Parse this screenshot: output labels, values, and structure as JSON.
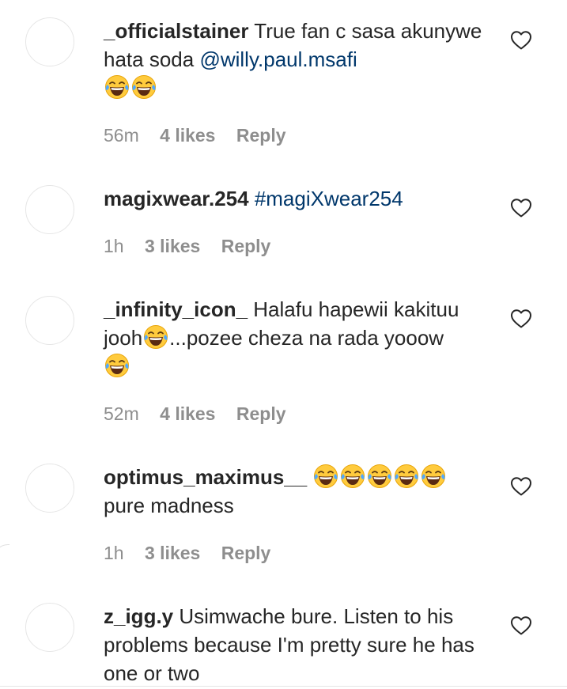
{
  "colors": {
    "username": "#262626",
    "link": "#00376b",
    "meta": "#8e8e8e"
  },
  "icons": {
    "like": "heart-outline-icon",
    "emoji": "face-with-tears-of-joy"
  },
  "comments": [
    {
      "username": "_officialstainer",
      "text_before": "True fan c sasa akunywe hata soda",
      "mention": "@willy.paul.msafi",
      "emoji_count": 2,
      "time": "56m",
      "likes": "4 likes",
      "reply": "Reply"
    },
    {
      "username": "magixwear.254",
      "hashtag": "#magiXwear254",
      "time": "1h",
      "likes": "3 likes",
      "reply": "Reply"
    },
    {
      "username": "_infinity_icon_",
      "text_before": "Halafu hapewii kakituu jooh",
      "text_after": "...pozee cheza na rada yooow",
      "time": "52m",
      "likes": "4 likes",
      "reply": "Reply"
    },
    {
      "username": "optimus_maximus__",
      "emoji_count": 5,
      "text_after": "pure madness",
      "time": "1h",
      "likes": "3 likes",
      "reply": "Reply"
    },
    {
      "username": "z_igg.y",
      "text_before": "Usimwache bure. Listen to his problems because I'm pretty sure he has one or two"
    }
  ]
}
